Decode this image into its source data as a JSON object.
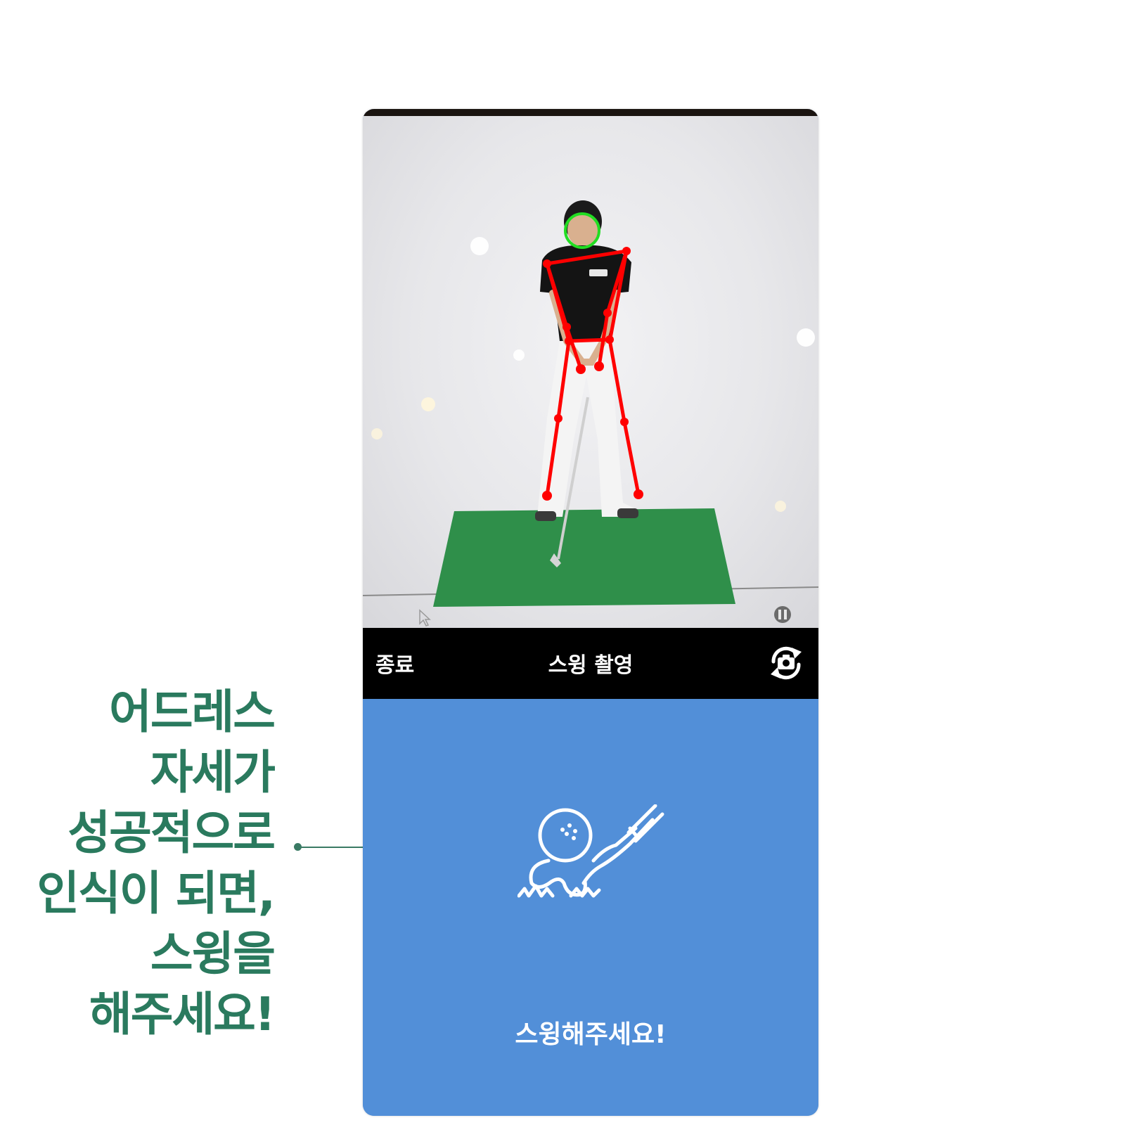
{
  "callout": {
    "lines": [
      "어드레스",
      "자세가",
      "성공적으로",
      "인식이 되면,",
      "스윙을",
      "해주세요!"
    ],
    "color": "#2a7a5e"
  },
  "camera": {
    "skeleton_color": "#ff0000",
    "head_marker_color": "#22dd22",
    "mat_color": "#2f8f4a",
    "icons": [
      "pause-icon",
      "cursor-icon"
    ]
  },
  "topbar": {
    "end_label": "종료",
    "title": "스윙 촬영",
    "switch_icon": "camera-switch-icon"
  },
  "bottom": {
    "background": "#528fd8",
    "icon": "golf-ball-club-icon",
    "message": "스윙해주세요!"
  }
}
